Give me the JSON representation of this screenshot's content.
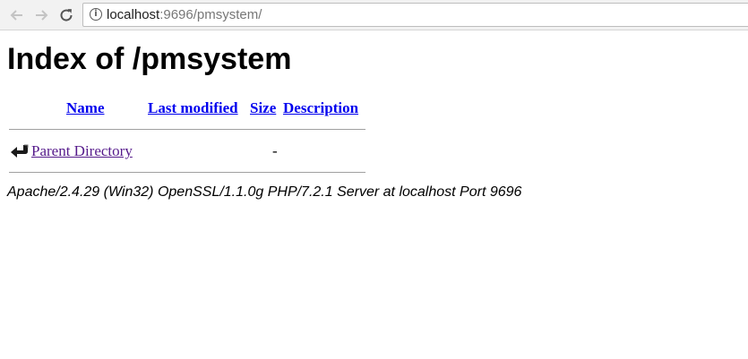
{
  "browser": {
    "url_host": "localhost",
    "url_rest": ":9696/pmsystem/",
    "back_icon": "arrow-left-icon",
    "forward_icon": "arrow-right-icon",
    "reload_icon": "reload-icon",
    "info_icon": "info-icon"
  },
  "page": {
    "title": "Index of /pmsystem",
    "columns": {
      "name": "Name",
      "last_modified": "Last modified",
      "size": "Size",
      "description": "Description"
    },
    "rows": [
      {
        "icon": "back-arrow-icon",
        "name": "Parent Directory",
        "last_modified": "",
        "size": "-",
        "description": ""
      }
    ],
    "signature": "Apache/2.4.29 (Win32) OpenSSL/1.1.0g PHP/7.2.1 Server at localhost Port 9696"
  },
  "colors": {
    "link": "#0000ee",
    "visited_link": "#551a8b",
    "toolbar_bg": "#f2f2f2"
  }
}
